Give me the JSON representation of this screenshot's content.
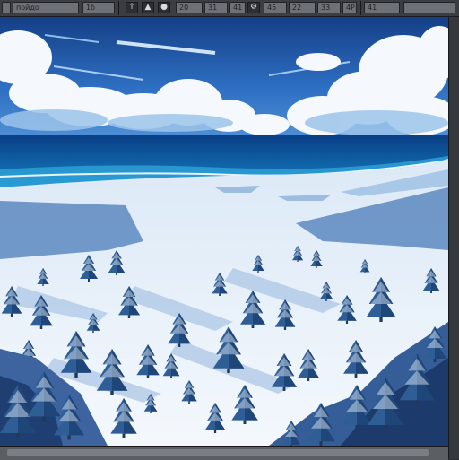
{
  "toolbar": {
    "search_value": "пойдо",
    "page_value": "1б",
    "fields": [
      "20",
      "31",
      "41",
      "45",
      "22",
      "33",
      "4Р",
      "41"
    ]
  },
  "colors": {
    "sky": "#1d4f9c",
    "ocean": "#0d5fa6",
    "snow": "#eef4fb",
    "tree": "#2c5a92"
  },
  "icons": [
    "pointer-icon",
    "lamp-icon",
    "circle-icon",
    "settings-icon"
  ]
}
